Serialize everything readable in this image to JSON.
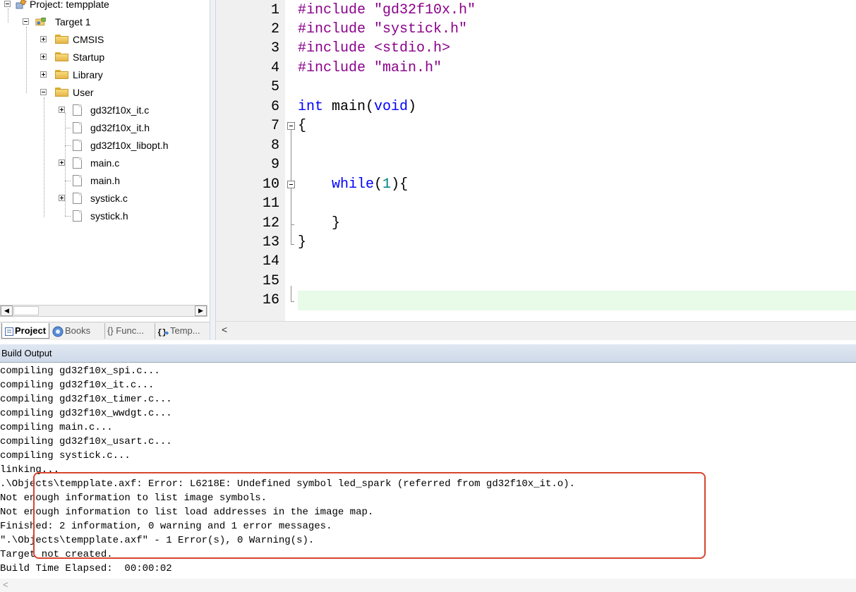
{
  "project_panel": {
    "project_label": "Project: tempplate",
    "target_label": "Target 1",
    "groups": [
      "CMSIS",
      "Startup",
      "Library",
      "User"
    ],
    "user_files": [
      {
        "name": "gd32f10x_it.c"
      },
      {
        "name": "gd32f10x_it.h"
      },
      {
        "name": "gd32f10x_libopt.h"
      },
      {
        "name": "main.c"
      },
      {
        "name": "main.h"
      },
      {
        "name": "systick.c"
      },
      {
        "name": "systick.h"
      }
    ],
    "tabs": [
      {
        "label": "Project",
        "icon": "project-icon"
      },
      {
        "label": "Books",
        "icon": "books-icon"
      },
      {
        "label": "{} Func...",
        "icon": "functions-icon"
      },
      {
        "label": "Temp...",
        "icon": "templates-icon"
      }
    ]
  },
  "editor": {
    "line_numbers": [
      "1",
      "2",
      "3",
      "4",
      "5",
      "6",
      "7",
      "8",
      "9",
      "10",
      "11",
      "12",
      "13",
      "14",
      "15",
      "16"
    ],
    "current_line": 16
  },
  "build_output": {
    "title": "Build Output",
    "lines": [
      "compiling gd32f10x_spi.c...",
      "compiling gd32f10x_it.c...",
      "compiling gd32f10x_timer.c...",
      "compiling gd32f10x_wwdgt.c...",
      "compiling main.c...",
      "compiling gd32f10x_usart.c...",
      "compiling systick.c...",
      "linking...",
      ".\\Objects\\tempplate.axf: Error: L6218E: Undefined symbol led_spark (referred from gd32f10x_it.o).",
      "Not enough information to list image symbols.",
      "Not enough information to list load addresses in the image map.",
      "Finished: 2 information, 0 warning and 1 error messages.",
      "\".\\Objects\\tempplate.axf\" - 1 Error(s), 0 Warning(s).",
      "Target not created.",
      "Build Time Elapsed:  00:00:02"
    ]
  },
  "colors": {
    "preprocessor": "#8b008b",
    "keyword": "#0000ff",
    "number": "#008080",
    "current_line_bg": "#e8fae8",
    "error_highlight": "#d9452e"
  }
}
